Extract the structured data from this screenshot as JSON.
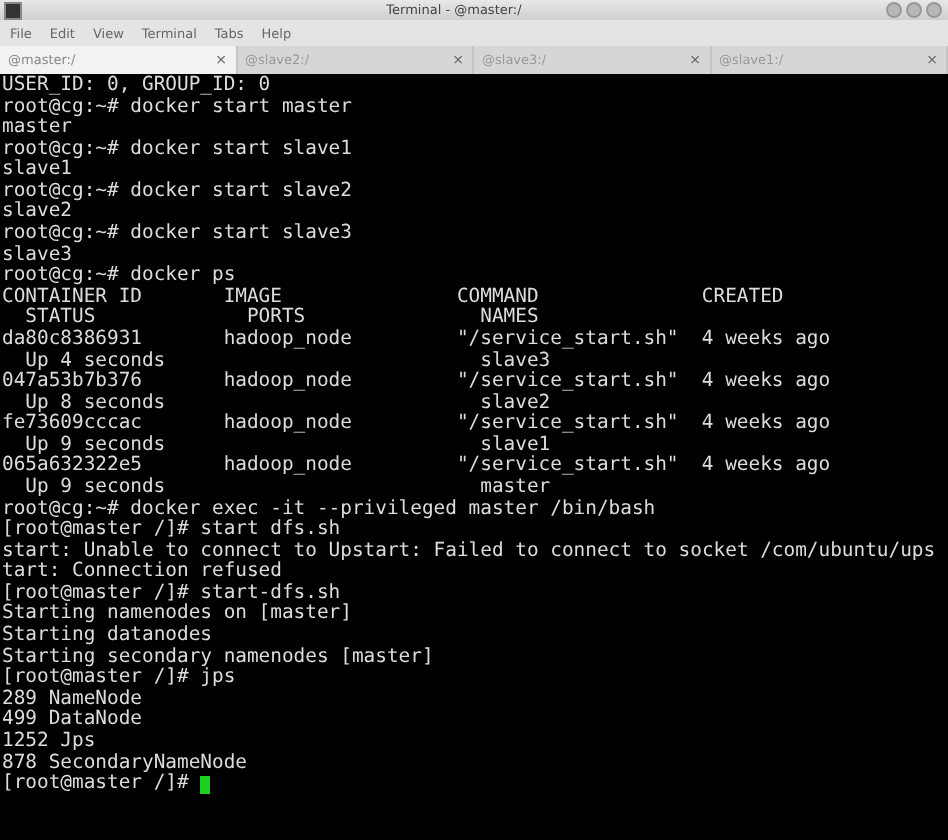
{
  "window": {
    "title": "Terminal - @master:/"
  },
  "menu": [
    "File",
    "Edit",
    "View",
    "Terminal",
    "Tabs",
    "Help"
  ],
  "tabs": [
    {
      "label": "@master:/",
      "close": "×",
      "selected": true
    },
    {
      "label": "@slave2:/",
      "close": "×",
      "selected": false
    },
    {
      "label": "@slave3:/",
      "close": "×",
      "selected": false
    },
    {
      "label": "@slave1:/",
      "close": "×",
      "selected": false
    }
  ],
  "terminal": {
    "lines": [
      {
        "kind": "text",
        "text": "USER_ID: 0, GROUP_ID: 0"
      },
      {
        "kind": "text",
        "text": "root@cg:~# docker start master"
      },
      {
        "kind": "text",
        "text": "master"
      },
      {
        "kind": "text",
        "text": "root@cg:~# docker start slave1"
      },
      {
        "kind": "text",
        "text": "slave1"
      },
      {
        "kind": "text",
        "text": "root@cg:~# docker start slave2"
      },
      {
        "kind": "text",
        "text": "slave2"
      },
      {
        "kind": "text",
        "text": "root@cg:~# docker start slave3"
      },
      {
        "kind": "text",
        "text": "slave3"
      },
      {
        "kind": "text",
        "text": "root@cg:~# docker ps"
      },
      {
        "kind": "main",
        "cells": [
          "CONTAINER ID",
          "IMAGE",
          "COMMAND",
          "CREATED"
        ]
      },
      {
        "kind": "sub",
        "status": "STATUS",
        "ports": "PORTS",
        "names": "NAMES"
      },
      {
        "kind": "main",
        "cells": [
          "da80c8386931",
          "hadoop_node",
          "\"/service_start.sh\"",
          "4 weeks ago"
        ]
      },
      {
        "kind": "sub",
        "status": "Up 4 seconds",
        "names": "slave3"
      },
      {
        "kind": "main",
        "cells": [
          "047a53b7b376",
          "hadoop_node",
          "\"/service_start.sh\"",
          "4 weeks ago"
        ]
      },
      {
        "kind": "sub",
        "status": "Up 8 seconds",
        "names": "slave2"
      },
      {
        "kind": "main",
        "cells": [
          "fe73609cccac",
          "hadoop_node",
          "\"/service_start.sh\"",
          "4 weeks ago"
        ]
      },
      {
        "kind": "sub",
        "status": "Up 9 seconds",
        "names": "slave1"
      },
      {
        "kind": "main",
        "cells": [
          "065a632322e5",
          "hadoop_node",
          "\"/service_start.sh\"",
          "4 weeks ago"
        ]
      },
      {
        "kind": "sub",
        "status": "Up 9 seconds",
        "names": "master"
      },
      {
        "kind": "text",
        "text": "root@cg:~# docker exec -it --privileged master /bin/bash"
      },
      {
        "kind": "text",
        "text": "[root@master /]# start dfs.sh"
      },
      {
        "kind": "text",
        "text": "start: Unable to connect to Upstart: Failed to connect to socket /com/ubuntu/ups"
      },
      {
        "kind": "text",
        "text": "tart: Connection refused"
      },
      {
        "kind": "text",
        "text": "[root@master /]# start-dfs.sh"
      },
      {
        "kind": "text",
        "text": "Starting namenodes on [master]"
      },
      {
        "kind": "text",
        "text": "Starting datanodes"
      },
      {
        "kind": "text",
        "text": "Starting secondary namenodes [master]"
      },
      {
        "kind": "text",
        "text": "[root@master /]# jps"
      },
      {
        "kind": "text",
        "text": "289 NameNode"
      },
      {
        "kind": "text",
        "text": "499 DataNode"
      },
      {
        "kind": "text",
        "text": "1252 Jps"
      },
      {
        "kind": "text",
        "text": "878 SecondaryNameNode"
      },
      {
        "kind": "prompt",
        "text": "[root@master /]#",
        "cursor": true
      }
    ]
  }
}
